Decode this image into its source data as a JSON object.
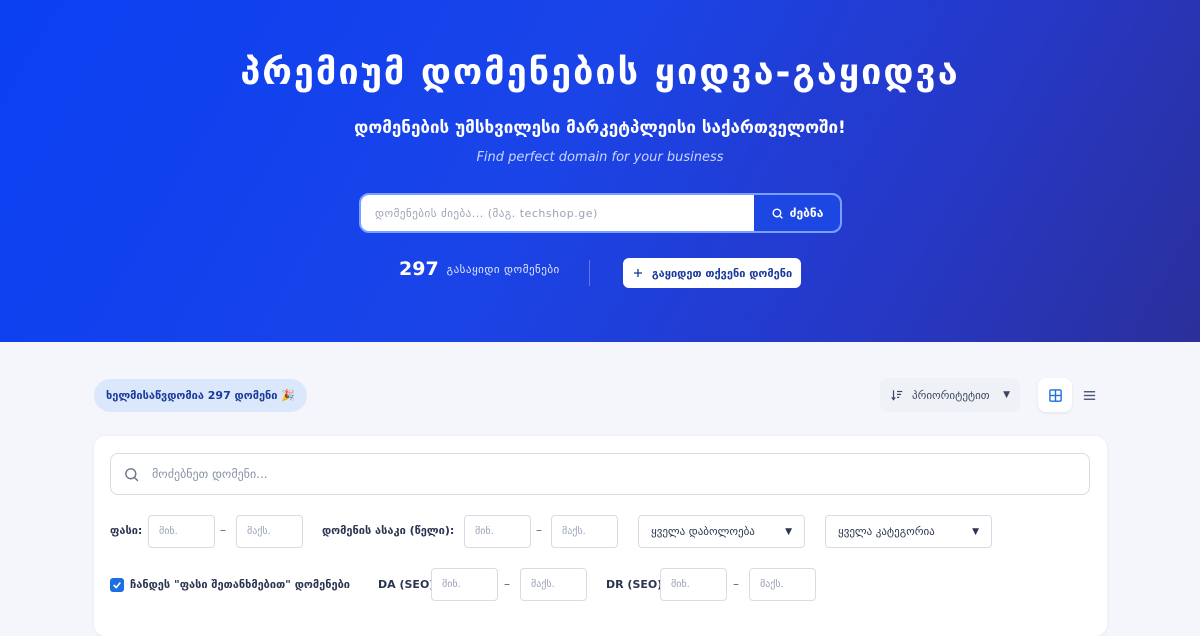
{
  "hero": {
    "title": "პრემიუმ დომენების ყიდვა-გაყიდვა",
    "subtitle": "დომენების უმსხვილესი მარკეტპლეისი საქართველოში!",
    "subtitle_en": "Find perfect domain for your business",
    "search_placeholder": "დომენების ძიება... (მაგ. techshop.ge)",
    "search_button": "ძებნა",
    "stats_count": "297",
    "stats_label": "გასაყიდი დომენები",
    "sell_button": "გაყიდეთ თქვენი დომენი"
  },
  "toolbar": {
    "available_badge": "ხელმისაწვდომია 297 დომენი 🎉",
    "sort_label": "პრიორიტეტით"
  },
  "filters": {
    "search_placeholder": "მოძებნეთ დომენი...",
    "price_label": "ფასი:",
    "age_label": "დომენის ასაკი (წელი):",
    "min_placeholder": "მინ.",
    "max_placeholder": "მაქს.",
    "dash": "–",
    "ending_select": "ყველა დაბოლოება",
    "category_select": "ყველა კატეგორია",
    "negotiable_label": "ჩანდეს \"ფასი შეთანხმებით\" დომენები",
    "da_label": "DA (SEO):",
    "dr_label": "DR (SEO):"
  },
  "colors": {
    "primary": "#1c47e2",
    "hero_start": "#0a3ff2",
    "hero_end": "#2a2f9a"
  }
}
